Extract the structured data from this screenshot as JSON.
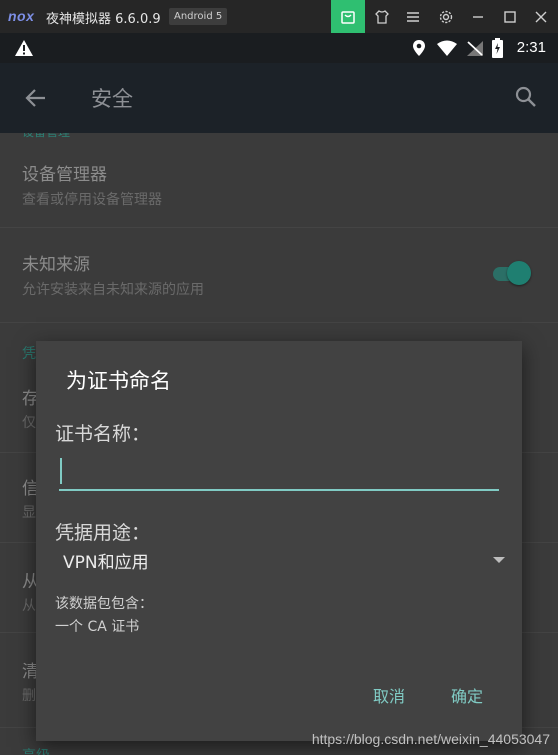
{
  "emulator": {
    "logo": "nox",
    "title": "夜神模拟器 6.6.0.9",
    "badge": "Android 5",
    "buttons": [
      "store-icon",
      "shirt-icon",
      "menu-icon",
      "settings-icon",
      "minimize-icon",
      "maximize-icon",
      "close-icon"
    ],
    "accent": "#2fbf71"
  },
  "status_bar": {
    "time": "2:31"
  },
  "app_bar": {
    "title": "安全"
  },
  "settings": {
    "rows": [
      {
        "title": "设备管理器",
        "subtitle": "查看或停用设备管理器"
      },
      {
        "title": "未知来源",
        "subtitle": "允许安装来自未知来源的应用",
        "toggle_on": true
      }
    ],
    "section_partial": "凭",
    "partial_rows": [
      {
        "title": "存",
        "subtitle": "仅"
      },
      {
        "title": "信",
        "subtitle": "显"
      },
      {
        "title": "从",
        "subtitle": "从"
      },
      {
        "title": "清",
        "subtitle": "删"
      }
    ],
    "bottom_section_partial": "高级"
  },
  "dialog": {
    "title": "为证书命名",
    "name_label": "证书名称：",
    "name_value": "",
    "usage_label": "凭据用途：",
    "usage_value": "VPN和应用",
    "contains_label": "该数据包包含：",
    "contains_value": "一个 CA 证书",
    "cancel_label": "取消",
    "ok_label": "确定",
    "accent": "#80cbc4"
  },
  "watermark": "https://blog.csdn.net/weixin_44053047"
}
